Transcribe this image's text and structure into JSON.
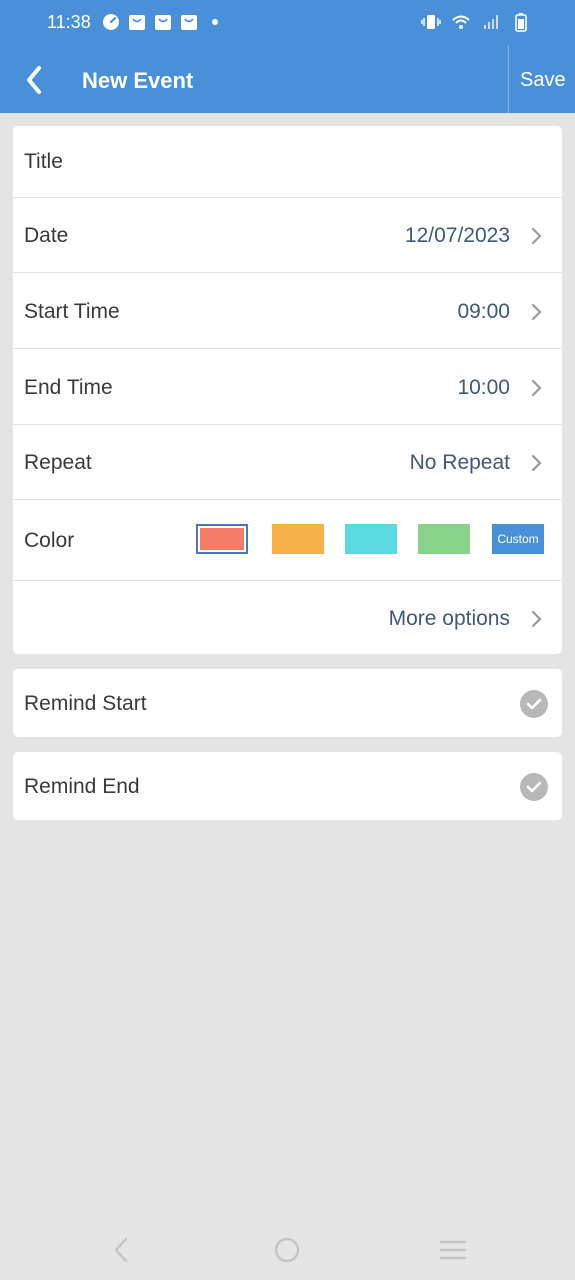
{
  "status_bar": {
    "time": "11:38",
    "left_icons": [
      "speedometer-icon",
      "shopping-bag-icon",
      "shopping-bag-icon",
      "shopping-bag-icon",
      "dot-icon"
    ],
    "right_icons": [
      "vibrate-icon",
      "wifi-icon",
      "signal-icon",
      "battery-icon"
    ]
  },
  "appbar": {
    "title": "New Event",
    "save_label": "Save",
    "background": "#4a90d9"
  },
  "form": {
    "title_label": "Title",
    "date_label": "Date",
    "date_value": "12/07/2023",
    "start_time_label": "Start Time",
    "start_time_value": "09:00",
    "end_time_label": "End Time",
    "end_time_value": "10:00",
    "repeat_label": "Repeat",
    "repeat_value": "No Repeat",
    "color_label": "Color",
    "colors": [
      "#f47c68",
      "#f7b04a",
      "#5ad9e0",
      "#88d28a"
    ],
    "selected_color_index": 0,
    "custom_label": "Custom",
    "more_options_label": "More options"
  },
  "reminders": {
    "remind_start_label": "Remind Start",
    "remind_end_label": "Remind End"
  },
  "nav": {
    "icons": [
      "back-icon",
      "home-icon",
      "recents-icon"
    ]
  }
}
